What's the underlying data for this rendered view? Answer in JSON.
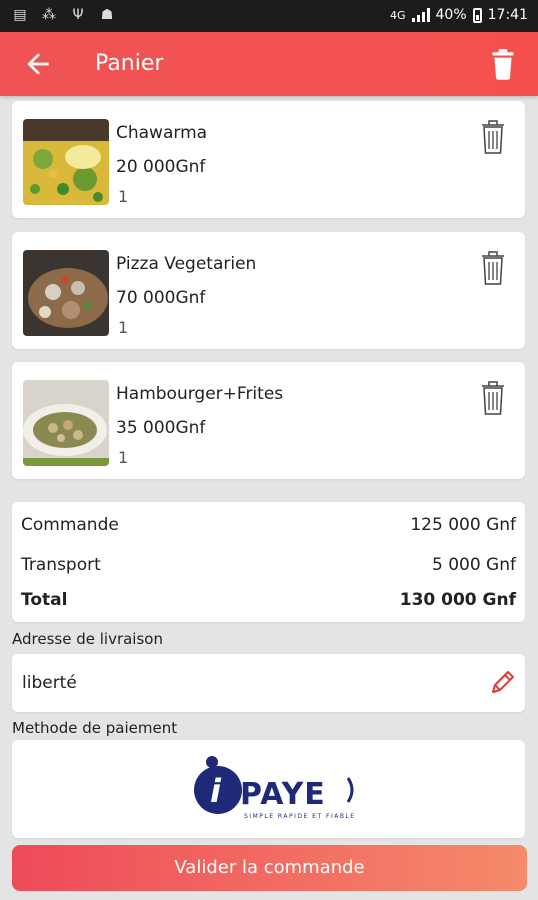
{
  "status_bar": {
    "network": "4G",
    "battery": "40%",
    "time": "17:41"
  },
  "header": {
    "title": "Panier"
  },
  "cart": {
    "items": [
      {
        "name": "Chawarma",
        "price": "20 000Gnf",
        "qty": "1"
      },
      {
        "name": "Pizza Vegetarien",
        "price": "70 000Gnf",
        "qty": "1"
      },
      {
        "name": "Hambourger+Frites",
        "price": "35 000Gnf",
        "qty": "1"
      }
    ]
  },
  "summary": {
    "order_label": "Commande",
    "order_value": "125 000 Gnf",
    "transport_label": "Transport",
    "transport_value": "5 000 Gnf",
    "total_label": "Total",
    "total_value": "130 000 Gnf"
  },
  "address": {
    "label": "Adresse de livraison",
    "value": "liberté"
  },
  "payment": {
    "label": "Methode de paiement",
    "logo_text": "iPAYE",
    "logo_tagline": "SIMPLE RAPIDE ET FIABLE"
  },
  "actions": {
    "submit_label": "Valider la commande"
  },
  "colors": {
    "primary": "#f4514e",
    "button_gradient_start": "#ee4b59",
    "button_gradient_end": "#f58a6a",
    "logo_blue": "#1e2a78"
  }
}
